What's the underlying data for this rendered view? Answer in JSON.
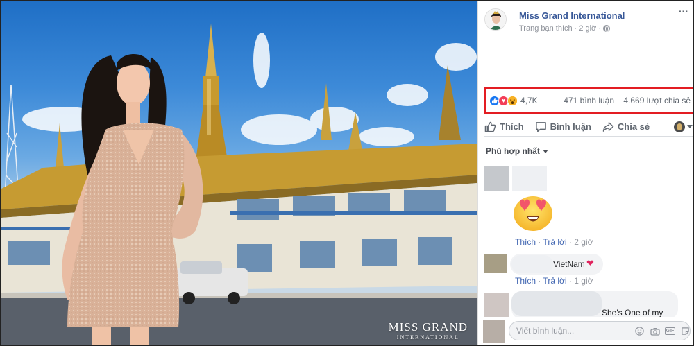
{
  "photo": {
    "watermark_line1": "MISS GRAND",
    "watermark_line2": "INTERNATIONAL"
  },
  "post": {
    "page_name": "Miss Grand International",
    "meta_liked": "Trang bạn thích",
    "meta_separator": "·",
    "meta_time": "2 giờ",
    "reactions": {
      "icons": [
        "like-icon",
        "love-icon",
        "wow-icon"
      ],
      "total": "4,7K"
    },
    "comments_count": "471 bình luận",
    "shares_count": "4.669 lượt chia sẻ"
  },
  "actions": {
    "like": "Thích",
    "comment": "Bình luận",
    "share": "Chia sẻ"
  },
  "sort": {
    "label": "Phù hợp nhất"
  },
  "comments": [
    {
      "emoji": "heart-eyes-emoji",
      "like": "Thích",
      "reply": "Trả lời",
      "time": "2 giờ"
    },
    {
      "text": "VietNam",
      "emoji": "heart-icon",
      "like": "Thích",
      "reply": "Trả lời",
      "time": "1 giờ"
    },
    {
      "text": "She's One of my"
    }
  ],
  "composer": {
    "placeholder": "Viết bình luận...",
    "icons": [
      "smiley-icon",
      "camera-icon",
      "gif-icon",
      "sticker-icon"
    ]
  },
  "colors": {
    "facebook_blue": "#385898",
    "link_blue": "#4267b2",
    "highlight_red": "#e31d23",
    "like_blue": "#1877f2",
    "love_red": "#f33e58",
    "wow_yellow": "#f7b125"
  }
}
